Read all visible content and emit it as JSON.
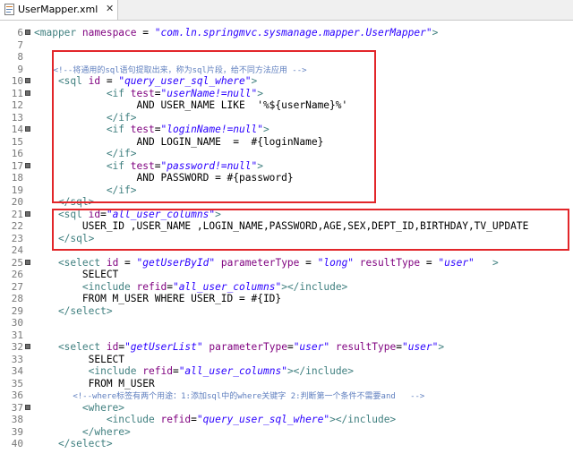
{
  "tab": {
    "label": "UserMapper.xml",
    "close": "✕"
  },
  "lines": [
    {
      "n": "6",
      "fold": true,
      "parts": [
        [
          "tag",
          "<mapper "
        ],
        [
          "attr",
          "namespace"
        ],
        [
          "txt",
          " = "
        ],
        [
          "val",
          "\"com.ln.springmvc.sysmanage.mapper.UserMapper\""
        ],
        [
          "tag",
          ">"
        ]
      ]
    },
    {
      "n": "7",
      "fold": false,
      "parts": []
    },
    {
      "n": "8",
      "fold": false,
      "parts": []
    },
    {
      "n": "9",
      "fold": false,
      "parts": [
        [
          "cmt",
          "    <!--将通用的sql语句提取出来，称为sql片段，给不同方法应用 -->"
        ]
      ]
    },
    {
      "n": "10",
      "fold": true,
      "parts": [
        [
          "tag",
          "    <sql "
        ],
        [
          "attr",
          "id"
        ],
        [
          "txt",
          " = "
        ],
        [
          "val",
          "\"query_user_sql_where\""
        ],
        [
          "tag",
          ">"
        ]
      ]
    },
    {
      "n": "11",
      "fold": true,
      "parts": [
        [
          "tag",
          "            <if "
        ],
        [
          "attr",
          "test"
        ],
        [
          "txt",
          "="
        ],
        [
          "val",
          "\"userName!=null\""
        ],
        [
          "tag",
          ">"
        ]
      ]
    },
    {
      "n": "12",
      "fold": false,
      "parts": [
        [
          "txt",
          "                 AND USER_NAME LIKE  '%${userName}%'"
        ]
      ]
    },
    {
      "n": "13",
      "fold": false,
      "parts": [
        [
          "tag",
          "            </if>"
        ]
      ]
    },
    {
      "n": "14",
      "fold": true,
      "parts": [
        [
          "tag",
          "            <if "
        ],
        [
          "attr",
          "test"
        ],
        [
          "txt",
          "="
        ],
        [
          "val",
          "\"loginName!=null\""
        ],
        [
          "tag",
          ">"
        ]
      ]
    },
    {
      "n": "15",
      "fold": false,
      "parts": [
        [
          "txt",
          "                 AND LOGIN_NAME  =  #{loginName}"
        ]
      ]
    },
    {
      "n": "16",
      "fold": false,
      "parts": [
        [
          "tag",
          "            </if>"
        ]
      ]
    },
    {
      "n": "17",
      "fold": true,
      "parts": [
        [
          "tag",
          "            <if "
        ],
        [
          "attr",
          "test"
        ],
        [
          "txt",
          "="
        ],
        [
          "val",
          "\"password!=null\""
        ],
        [
          "tag",
          ">"
        ]
      ]
    },
    {
      "n": "18",
      "fold": false,
      "parts": [
        [
          "txt",
          "                 AND PASSWORD = #{password}"
        ]
      ]
    },
    {
      "n": "19",
      "fold": false,
      "parts": [
        [
          "tag",
          "            </if>"
        ]
      ]
    },
    {
      "n": "20",
      "fold": false,
      "parts": [
        [
          "tag",
          "    </sql>"
        ]
      ]
    },
    {
      "n": "21",
      "fold": true,
      "parts": [
        [
          "tag",
          "    <sql "
        ],
        [
          "attr",
          "id"
        ],
        [
          "txt",
          "="
        ],
        [
          "val",
          "\"all_user_columns\""
        ],
        [
          "tag",
          ">"
        ]
      ]
    },
    {
      "n": "22",
      "fold": false,
      "parts": [
        [
          "txt",
          "        USER_ID ,USER_NAME ,LOGIN_NAME,PASSWORD,AGE,SEX,DEPT_ID,BIRTHDAY,TV_UPDATE"
        ]
      ]
    },
    {
      "n": "23",
      "fold": false,
      "parts": [
        [
          "tag",
          "    </sql>"
        ]
      ]
    },
    {
      "n": "24",
      "fold": false,
      "parts": []
    },
    {
      "n": "25",
      "fold": true,
      "parts": [
        [
          "tag",
          "    <select "
        ],
        [
          "attr",
          "id"
        ],
        [
          "txt",
          " = "
        ],
        [
          "val",
          "\"getUserById\""
        ],
        [
          "txt",
          " "
        ],
        [
          "attr",
          "parameterType"
        ],
        [
          "txt",
          " = "
        ],
        [
          "val",
          "\"long\""
        ],
        [
          "txt",
          " "
        ],
        [
          "attr",
          "resultType"
        ],
        [
          "txt",
          " = "
        ],
        [
          "val",
          "\"user\""
        ],
        [
          "tag",
          "   >"
        ]
      ]
    },
    {
      "n": "26",
      "fold": false,
      "parts": [
        [
          "txt",
          "        SELECT"
        ]
      ]
    },
    {
      "n": "27",
      "fold": false,
      "parts": [
        [
          "tag",
          "        <include "
        ],
        [
          "attr",
          "refid"
        ],
        [
          "txt",
          "="
        ],
        [
          "val",
          "\"all_user_columns\""
        ],
        [
          "tag",
          "></include>"
        ]
      ]
    },
    {
      "n": "28",
      "fold": false,
      "parts": [
        [
          "txt",
          "        FROM M_USER WHERE USER_ID = #{ID}"
        ]
      ]
    },
    {
      "n": "29",
      "fold": false,
      "parts": [
        [
          "tag",
          "    </select>"
        ]
      ]
    },
    {
      "n": "30",
      "fold": false,
      "parts": []
    },
    {
      "n": "31",
      "fold": false,
      "parts": []
    },
    {
      "n": "32",
      "fold": true,
      "parts": [
        [
          "tag",
          "    <select "
        ],
        [
          "attr",
          "id"
        ],
        [
          "txt",
          "="
        ],
        [
          "val",
          "\"getUserList\""
        ],
        [
          "txt",
          " "
        ],
        [
          "attr",
          "parameterType"
        ],
        [
          "txt",
          "="
        ],
        [
          "val",
          "\"user\""
        ],
        [
          "txt",
          " "
        ],
        [
          "attr",
          "resultType"
        ],
        [
          "txt",
          "="
        ],
        [
          "val",
          "\"user\""
        ],
        [
          "tag",
          ">"
        ]
      ]
    },
    {
      "n": "33",
      "fold": false,
      "parts": [
        [
          "txt",
          "         SELECT"
        ]
      ]
    },
    {
      "n": "34",
      "fold": false,
      "parts": [
        [
          "tag",
          "         <include "
        ],
        [
          "attr",
          "refid"
        ],
        [
          "txt",
          "="
        ],
        [
          "val",
          "\"all_user_columns\""
        ],
        [
          "tag",
          "></include>"
        ]
      ]
    },
    {
      "n": "35",
      "fold": false,
      "parts": [
        [
          "txt",
          "         FROM M_USER"
        ]
      ]
    },
    {
      "n": "36",
      "fold": false,
      "parts": [
        [
          "cmt",
          "        <!--where标签有两个用途：1:添加sql中的where关键字 2:判断第一个条件不需要and   -->"
        ]
      ]
    },
    {
      "n": "37",
      "fold": true,
      "parts": [
        [
          "tag",
          "        <where>"
        ]
      ]
    },
    {
      "n": "38",
      "fold": false,
      "parts": [
        [
          "tag",
          "            <include "
        ],
        [
          "attr",
          "refid"
        ],
        [
          "txt",
          "="
        ],
        [
          "val",
          "\"query_user_sql_where\""
        ],
        [
          "tag",
          "></include>"
        ]
      ]
    },
    {
      "n": "39",
      "fold": false,
      "parts": [
        [
          "tag",
          "        </where>"
        ]
      ]
    },
    {
      "n": "40",
      "fold": false,
      "parts": [
        [
          "tag",
          "    </select>"
        ]
      ]
    }
  ]
}
